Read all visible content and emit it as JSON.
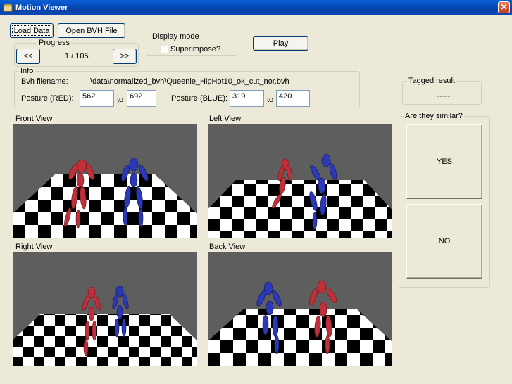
{
  "window": {
    "title": "Motion Viewer",
    "close_glyph": "✕"
  },
  "toolbar": {
    "load_label": "Load Data",
    "open_label": "Open BVH File",
    "play_label": "Play"
  },
  "progress": {
    "legend": "Progress",
    "prev_label": "<<",
    "next_label": ">>",
    "value": "1 / 105"
  },
  "display_mode": {
    "legend": "Display mode",
    "superimpose_label": "Superimpose?",
    "superimpose_checked": false
  },
  "info": {
    "legend": "Info",
    "bvh_label": "Bvh filename:",
    "bvh_value": "..\\data\\normalized_bvh\\Queenie_HipHot10_ok_cut_nor.bvh",
    "posture_red_label": "Posture (RED):",
    "red_from": "562",
    "to_label": "to",
    "red_to": "692",
    "posture_blue_label": "Posture (BLUE):",
    "blue_from": "319",
    "blue_to": "420"
  },
  "tagged": {
    "legend": "Tagged result",
    "value": "-----"
  },
  "similar": {
    "legend": "Are they similar?",
    "yes_label": "YES",
    "no_label": "NO"
  },
  "views": {
    "front": "Front View",
    "left": "Left View",
    "right": "Right View",
    "back": "Back View"
  },
  "colors": {
    "red_figure": "#c0303a",
    "blue_figure": "#2b38b8",
    "backdrop": "#5e5e5e"
  }
}
